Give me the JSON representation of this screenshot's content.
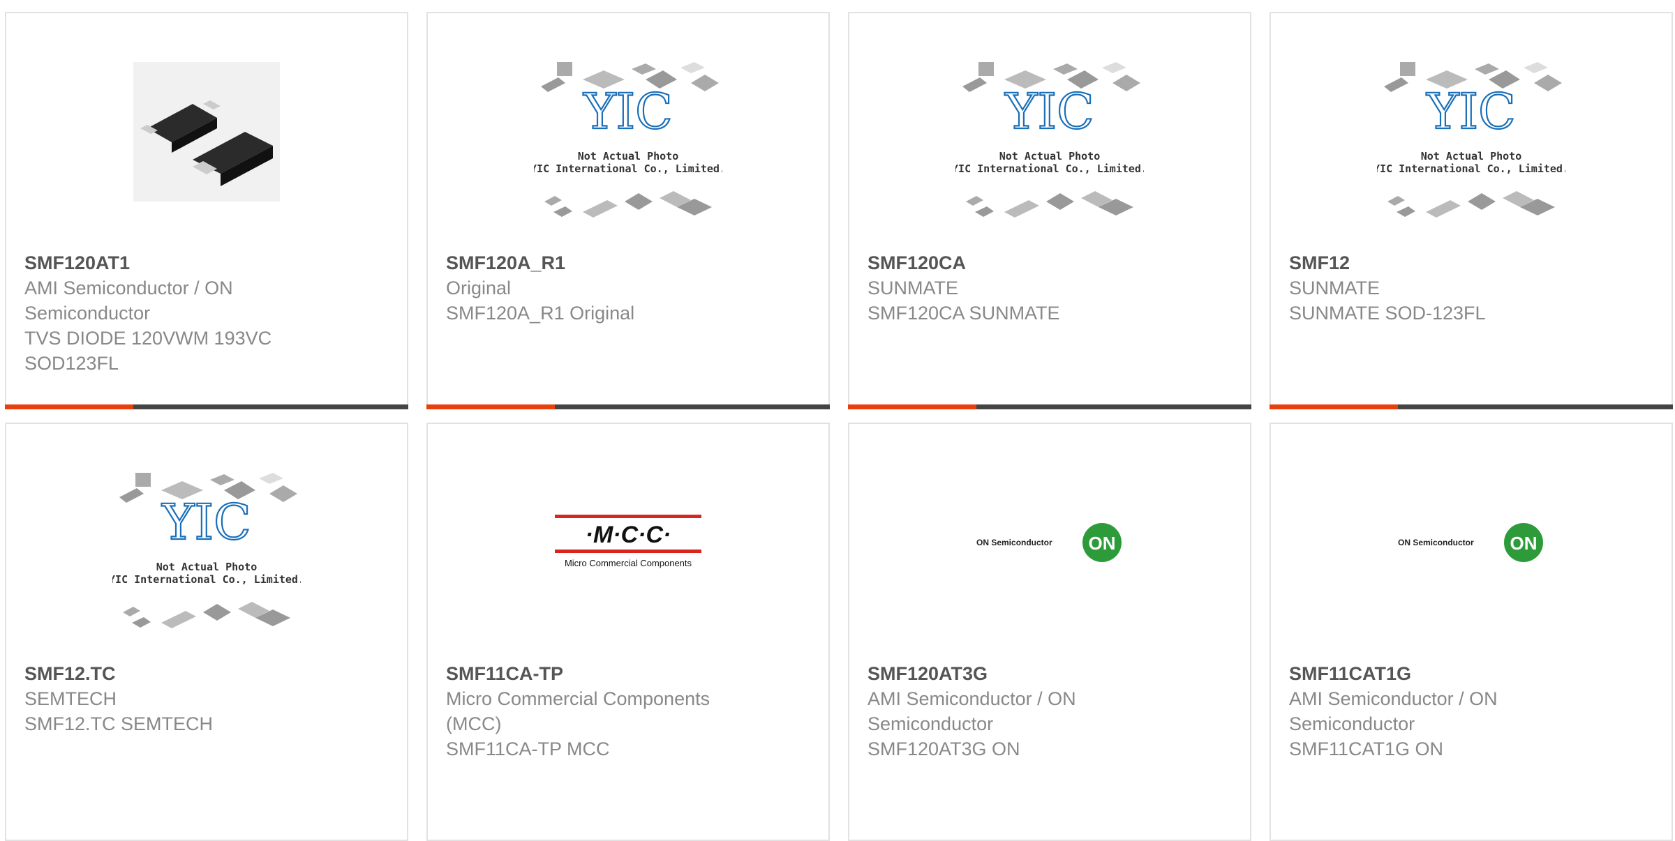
{
  "colors": {
    "accent": "#e8400c",
    "bar": "#444444",
    "yic_blue": "#1a6fb8",
    "on_green": "#2e9b3a",
    "mcc_red": "#d7261e"
  },
  "placeholder": {
    "line1": "Not Actual Photo",
    "line2": "YIC International Co., Limited.",
    "logo": "YIC"
  },
  "products": [
    {
      "part": "SMF120AT1",
      "manufacturer": [
        "AMI Semiconductor / ON",
        "Semiconductor"
      ],
      "description": [
        "TVS DIODE 120VWM 193VC",
        "SOD123FL"
      ],
      "image": "diode-photo"
    },
    {
      "part": "SMF120A_R1",
      "manufacturer": [
        "Original"
      ],
      "description": [
        "SMF120A_R1 Original"
      ],
      "image": "yic-placeholder"
    },
    {
      "part": "SMF120CA",
      "manufacturer": [
        "SUNMATE"
      ],
      "description": [
        "SMF120CA SUNMATE"
      ],
      "image": "yic-placeholder"
    },
    {
      "part": "SMF12",
      "manufacturer": [
        "SUNMATE"
      ],
      "description": [
        "SUNMATE SOD-123FL"
      ],
      "image": "yic-placeholder"
    },
    {
      "part": "SMF12.TC",
      "manufacturer": [
        "SEMTECH"
      ],
      "description": [
        "SMF12.TC SEMTECH"
      ],
      "image": "yic-placeholder"
    },
    {
      "part": "SMF11CA-TP",
      "manufacturer": [
        "Micro Commercial Components",
        "(MCC)"
      ],
      "description": [
        "SMF11CA-TP MCC"
      ],
      "image": "mcc-logo"
    },
    {
      "part": "SMF120AT3G",
      "manufacturer": [
        "AMI Semiconductor / ON",
        "Semiconductor"
      ],
      "description": [
        "SMF120AT3G ON"
      ],
      "image": "on-logo"
    },
    {
      "part": "SMF11CAT1G",
      "manufacturer": [
        "AMI Semiconductor / ON",
        "Semiconductor"
      ],
      "description": [
        "SMF11CAT1G ON"
      ],
      "image": "on-logo"
    }
  ],
  "mcc_logo": {
    "name": "·M·C·C·",
    "tagline": "Micro Commercial Components"
  },
  "on_logo": {
    "name": "ON Semiconductor",
    "badge": "ON"
  }
}
